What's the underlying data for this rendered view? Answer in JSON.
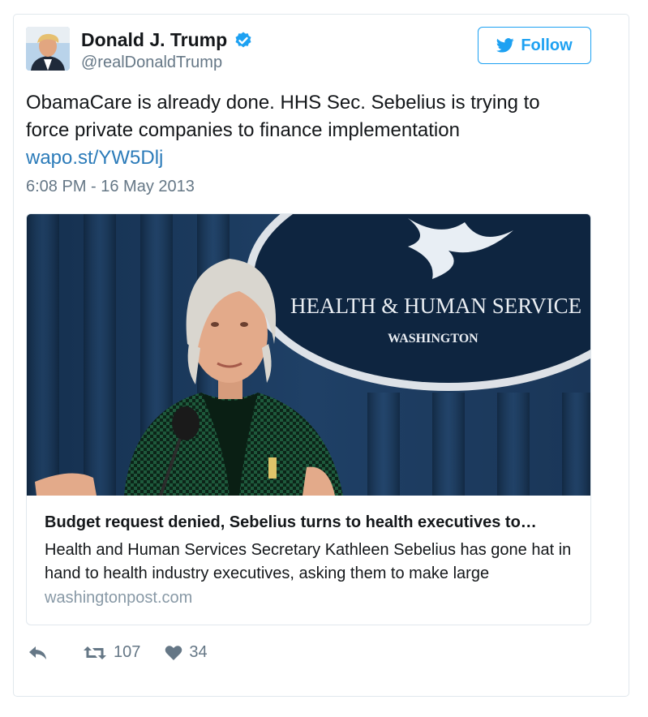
{
  "colors": {
    "accent": "#1da1f2",
    "link": "#2b7bb9",
    "muted": "#657786",
    "border": "#e1e8ed"
  },
  "author": {
    "name": "Donald J. Trump",
    "handle": "@realDonaldTrump",
    "verified": true,
    "avatar_icon": "profile-photo"
  },
  "follow_button": {
    "label": "Follow",
    "icon": "twitter-bird-icon"
  },
  "tweet": {
    "text": "ObamaCare is already done. HHS Sec. Sebelius is trying to force private companies to finance implementation",
    "link": "wapo.st/YW5Dlj",
    "timestamp": "6:08 PM - 16 May 2013"
  },
  "card": {
    "image_alt": "Kathleen Sebelius at podium in front of Health & Human Services seal",
    "seal_line1": "HEALTH & HUMAN SERVICE",
    "seal_line2": "WASHINGTON",
    "title": "Budget request denied, Sebelius turns to health executives to…",
    "description": "Health and Human Services Secretary Kathleen Sebelius has gone hat in hand to health industry executives, asking them to make large",
    "domain": "washingtonpost.com"
  },
  "actions": {
    "reply_icon": "reply-icon",
    "retweet_icon": "retweet-icon",
    "retweet_count": "107",
    "like_icon": "heart-icon",
    "like_count": "34"
  }
}
